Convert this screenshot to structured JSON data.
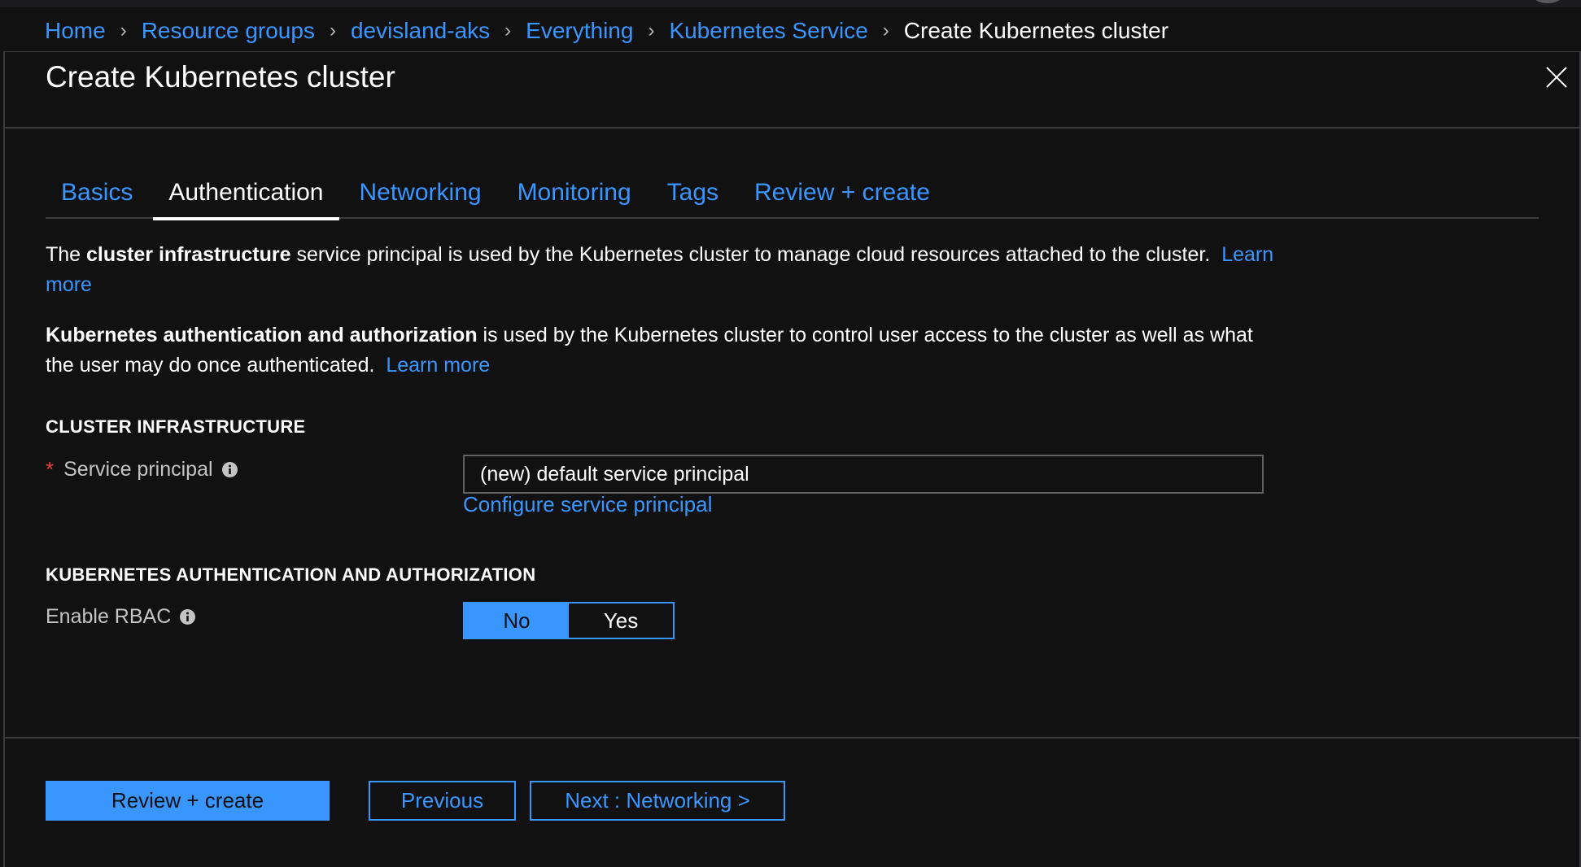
{
  "breadcrumb": {
    "items": [
      "Home",
      "Resource groups",
      "devisland-aks",
      "Everything",
      "Kubernetes Service"
    ],
    "current": "Create Kubernetes cluster"
  },
  "blade": {
    "title": "Create Kubernetes cluster"
  },
  "tabs": [
    {
      "label": "Basics",
      "active": false
    },
    {
      "label": "Authentication",
      "active": true
    },
    {
      "label": "Networking",
      "active": false
    },
    {
      "label": "Monitoring",
      "active": false
    },
    {
      "label": "Tags",
      "active": false
    },
    {
      "label": "Review + create",
      "active": false
    }
  ],
  "intro": {
    "p1_prefix": "The ",
    "p1_bold": "cluster infrastructure",
    "p1_text": " service principal is used by the Kubernetes cluster to manage cloud resources attached to the cluster.",
    "p1_link": "Learn more",
    "p2_bold": "Kubernetes authentication and authorization",
    "p2_text": " is used by the Kubernetes cluster to control user access to the cluster as well as what the user may do once authenticated.",
    "p2_link": "Learn more"
  },
  "cluster_infra": {
    "section_title": "CLUSTER INFRASTRUCTURE",
    "required_mark": "*",
    "service_principal_label": "Service principal",
    "service_principal_value": "(new) default service principal",
    "configure_link": "Configure service principal"
  },
  "k8s_auth": {
    "section_title": "KUBERNETES AUTHENTICATION AND AUTHORIZATION",
    "rbac_label": "Enable RBAC",
    "rbac_options": [
      "No",
      "Yes"
    ],
    "rbac_selected": "No"
  },
  "footer": {
    "review_create": "Review + create",
    "previous": "Previous",
    "next": "Next : Networking >"
  },
  "colors": {
    "accent": "#3a96ff",
    "background": "#111112",
    "required": "#e8413a"
  },
  "icons": {
    "close": "close-icon",
    "info": "info-icon",
    "chevron": "chevron-right-icon"
  }
}
